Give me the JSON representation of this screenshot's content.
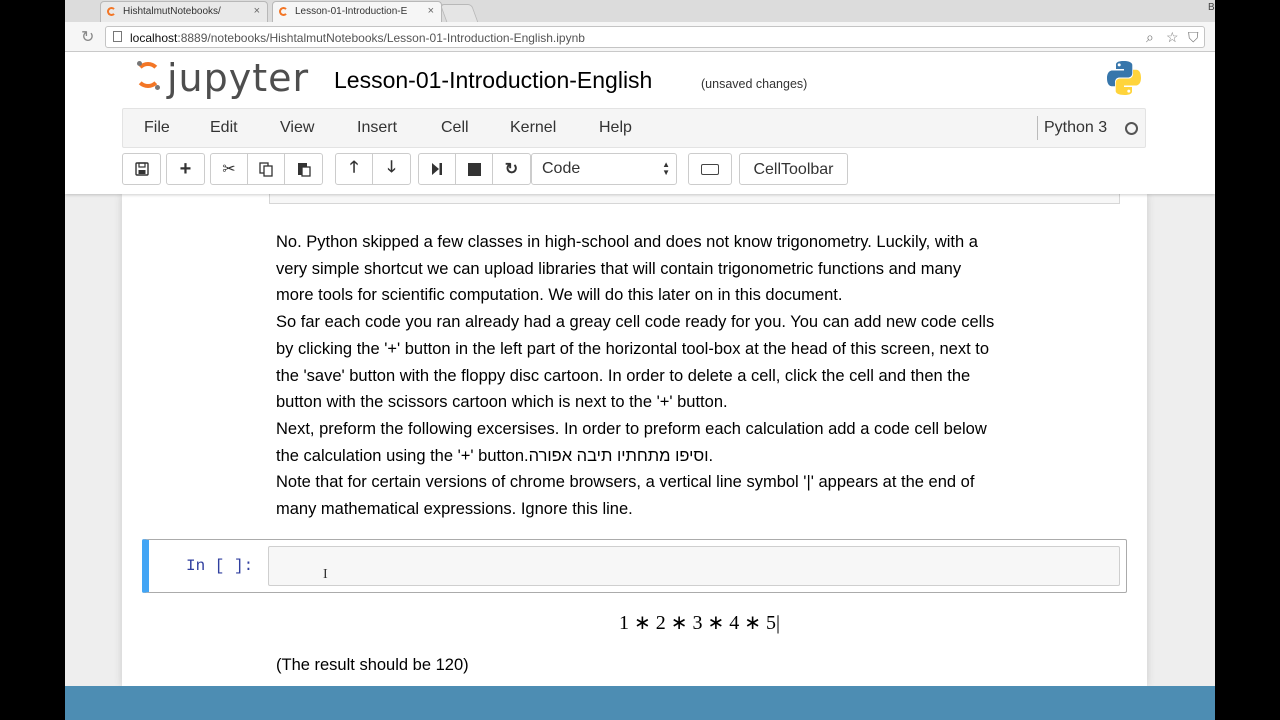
{
  "browser": {
    "tabs": [
      {
        "title": "HishtalmutNotebooks/",
        "close": "×"
      },
      {
        "title": "Lesson-01-Introduction-E",
        "close": "×"
      }
    ],
    "edge_letter": "B",
    "url_host": "localhost",
    "url_path": ":8889/notebooks/HishtalmutNotebooks/Lesson-01-Introduction-English.ipynb"
  },
  "jupyter": {
    "logo_text": "jupyter",
    "notebook_title": "Lesson-01-Introduction-English",
    "save_status": "(unsaved changes)",
    "menu": [
      "File",
      "Edit",
      "View",
      "Insert",
      "Cell",
      "Kernel",
      "Help"
    ],
    "kernel_name": "Python 3",
    "cell_type": "Code",
    "celltoolbar_label": "CellToolbar",
    "icons": {
      "save": "floppy-disk-icon",
      "insert": "plus-icon",
      "cut": "scissors-icon",
      "copy": "copy-icon",
      "paste": "paste-icon",
      "up": "arrow-up-icon",
      "down": "arrow-down-icon",
      "run": "step-forward-icon",
      "stop": "stop-icon",
      "restart": "restart-icon",
      "keyboard": "keyboard-icon"
    },
    "accent_color": "#f37626",
    "selected_cell_color": "#42a5f5"
  },
  "notebook": {
    "markdown_lines": [
      "No. Python skipped a few classes in high-school and does not know trigonometry. Luckily, with a",
      "very simple shortcut we can upload libraries that will contain trigonometric functions and many",
      "more tools for scientific computation. We will do this later on in this document.",
      "So far each code you ran already had a greay cell code ready for you. You can add new code cells",
      "by clicking the '+' button in the left part of the horizontal tool-box at the head of this screen, next to",
      "the 'save' button with the floppy disc cartoon. In order to delete a cell, click the cell and then the",
      "button with the scissors cartoon which is next to the '+' button.",
      "Next, preform the following excersises. In order to preform each calculation add a code cell below",
      "the calculation using the '+' button.וסיפו מתחתיו תיבה אפורה.",
      "Note that for certain versions of chrome browsers, a vertical line symbol '|' appears at the end of",
      "many mathematical expressions. Ignore this line."
    ],
    "prompt": "In [ ]:",
    "math_expression": "1 ∗ 2 ∗ 3 ∗ 4 ∗ 5|",
    "result_note": "(The result should be 120)"
  }
}
